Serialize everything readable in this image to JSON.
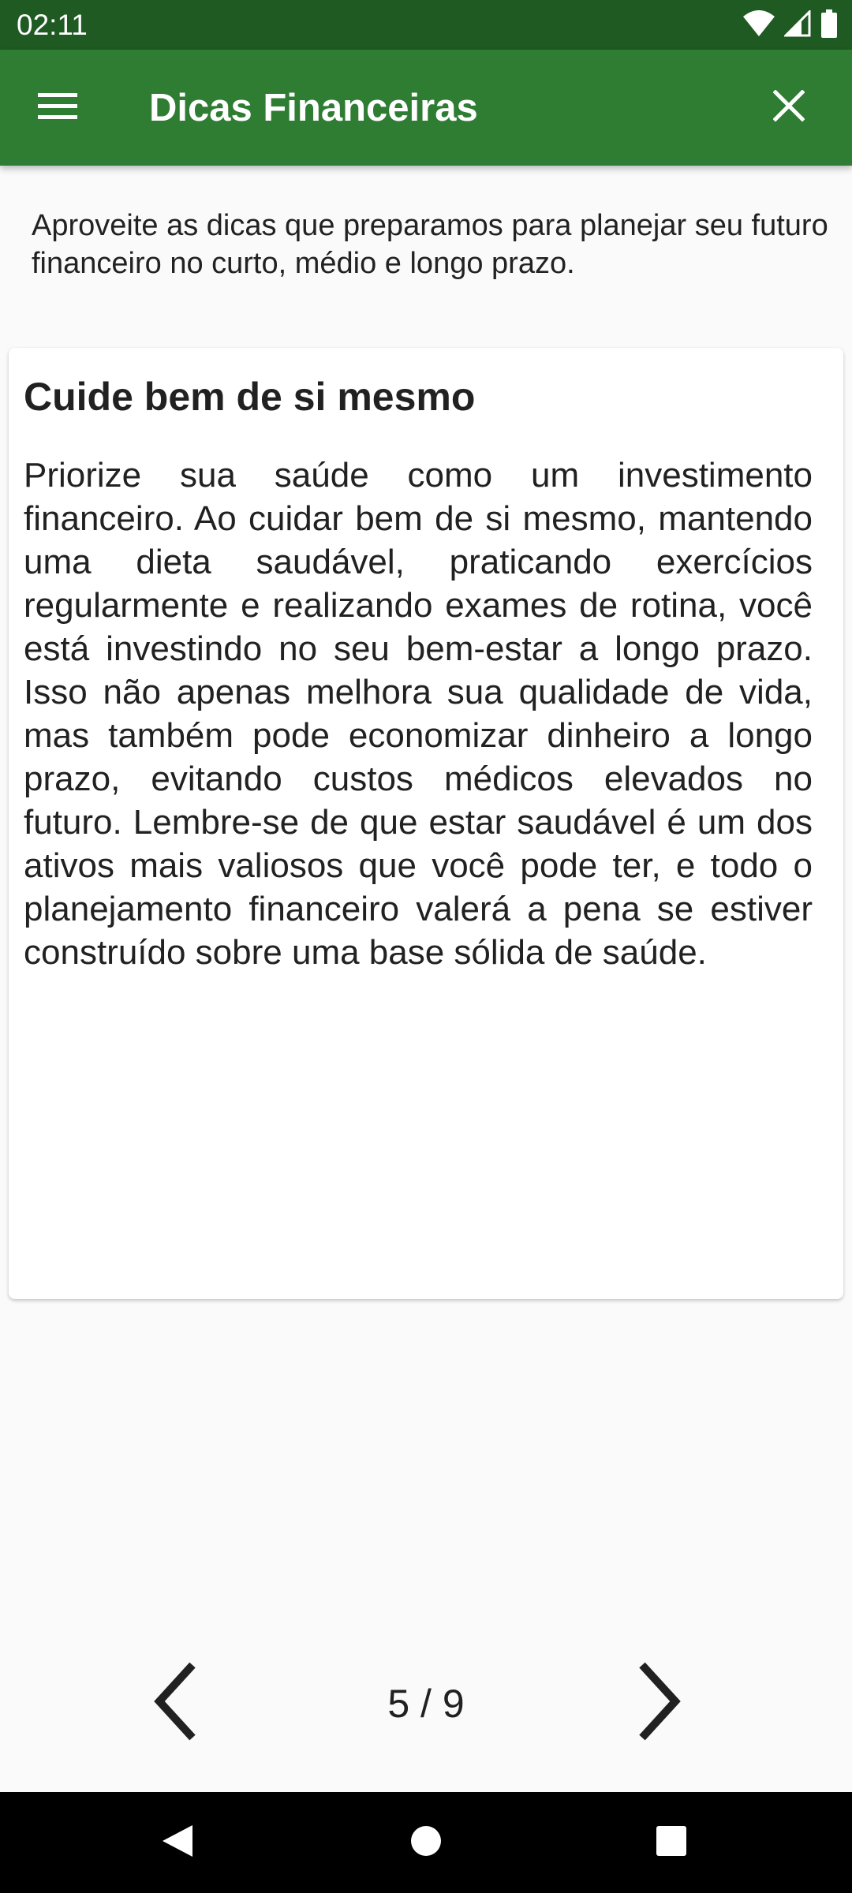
{
  "status_bar": {
    "time": "02:11",
    "icons": [
      "wifi-icon",
      "signal-icon",
      "battery-icon"
    ]
  },
  "app_bar": {
    "title": "Dicas Financeiras",
    "menu_icon": "hamburger-menu-icon",
    "close_icon": "close-icon",
    "color": "#2e7d32"
  },
  "intro": {
    "text": "Aproveite as dicas que preparamos para planejar seu futuro financeiro no curto, médio e longo prazo."
  },
  "tip": {
    "title": "Cuide bem de si mesmo",
    "body": "Priorize sua saúde como um investimento financeiro. Ao cuidar bem de si mesmo, mantendo uma dieta saudável, praticando exercícios regularmente e realizando exames de rotina, você está investindo no seu bem-estar a longo prazo. Isso não apenas melhora sua qualidade de vida, mas também pode economizar dinheiro a longo prazo, evitando custos médicos elevados no futuro. Lembre-se de que estar saudável é um dos ativos mais valiosos que você pode ter, e todo o planejamento financeiro valerá a pena se estiver construído sobre uma base sólida de saúde."
  },
  "pager": {
    "indicator": "5 / 9",
    "current": 5,
    "total": 9,
    "prev_icon": "chevron-left-icon",
    "next_icon": "chevron-right-icon"
  },
  "nav_bar": {
    "back_icon": "back-icon",
    "home_icon": "home-icon",
    "recents_icon": "recents-icon"
  }
}
